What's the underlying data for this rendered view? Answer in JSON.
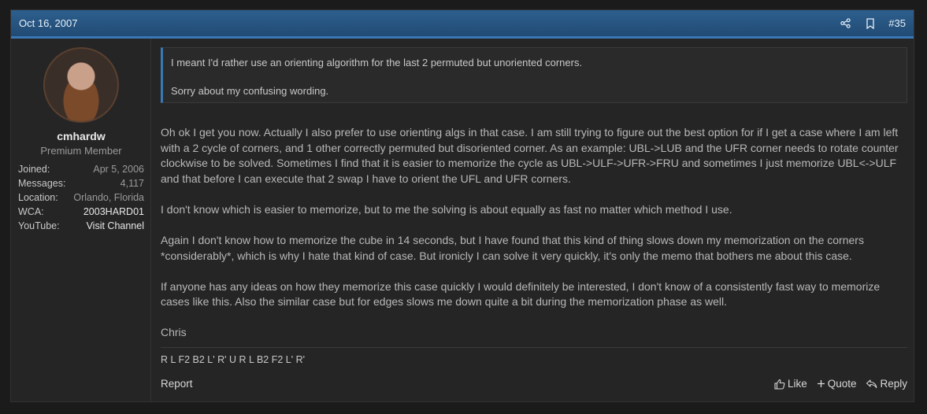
{
  "header": {
    "date": "Oct 16, 2007",
    "post_number": "#35",
    "share_icon": "share-icon",
    "bookmark_icon": "bookmark-icon"
  },
  "user": {
    "name": "cmhardw",
    "title": "Premium Member",
    "info": [
      {
        "label": "Joined:",
        "value": "Apr 5, 2006"
      },
      {
        "label": "Messages:",
        "value": "4,117"
      },
      {
        "label": "Location:",
        "value": "Orlando, Florida"
      },
      {
        "label": "WCA:",
        "value": "2003HARD01"
      },
      {
        "label": "YouTube:",
        "value": "Visit Channel"
      }
    ]
  },
  "quote": {
    "lines": [
      "I meant I'd rather use an orienting algorithm for the last 2 permuted but unoriented corners.",
      "Sorry about my confusing wording."
    ]
  },
  "body": {
    "paragraphs": [
      "Oh ok I get you now. Actually I also prefer to use orienting algs in that case. I am still trying to figure out the best option for if I get a case where I am left with a 2 cycle of corners, and 1 other correctly permuted but disoriented corner. As an example: UBL->LUB and the UFR corner needs to rotate counter clockwise to be solved. Sometimes I find that it is easier to memorize the cycle as UBL->ULF->UFR->FRU and sometimes I just memorize UBL<->ULF and that before I can execute that 2 swap I have to orient the UFL and UFR corners.",
      "I don't know which is easier to memorize, but to me the solving is about equally as fast no matter which method I use.",
      "Again I don't know how to memorize the cube in 14 seconds, but I have found that this kind of thing slows down my memorization on the corners *considerably*, which is why I hate that kind of case. But ironicly I can solve it very quickly, it's only the memo that bothers me about this case.",
      "If anyone has any ideas on how they memorize this case quickly I would definitely be interested, I don't know of a consistently fast way to memorize cases like this. Also the similar case but for edges slows me down quite a bit during the memorization phase as well.",
      "Chris"
    ]
  },
  "signature": "R L F2 B2 L' R' U R L B2 F2 L' R'",
  "footer": {
    "report": "Report",
    "like": "Like",
    "quote": "Quote",
    "reply": "Reply"
  }
}
